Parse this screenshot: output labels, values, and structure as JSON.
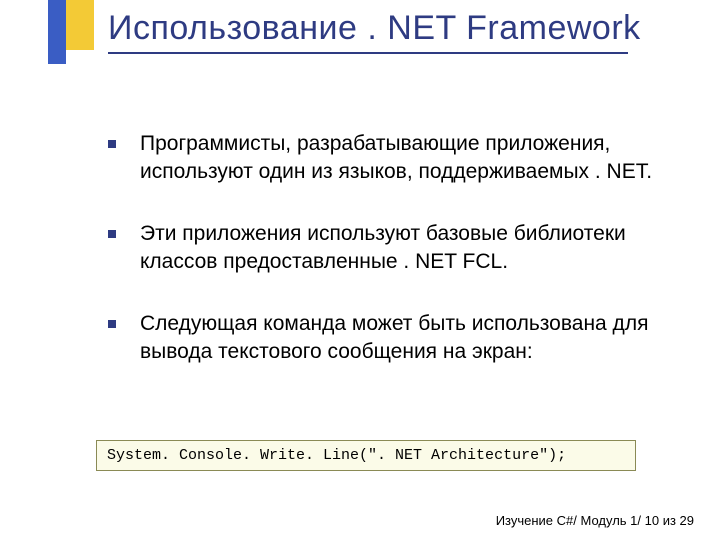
{
  "title": "Использование . NET Framework",
  "bullets": [
    "Программисты, разрабатывающие приложения, используют один из языков, поддерживаемых . NET.",
    "Эти приложения используют базовые библиотеки классов предоставленные . NET FCL.",
    "Следующая команда может быть использована для вывода текстового сообщения на экран:"
  ],
  "code": "System. Console. Write. Line(\". NET Architecture\");",
  "footer": "Изучение C#/ Модуль 1/ 10 из 29"
}
